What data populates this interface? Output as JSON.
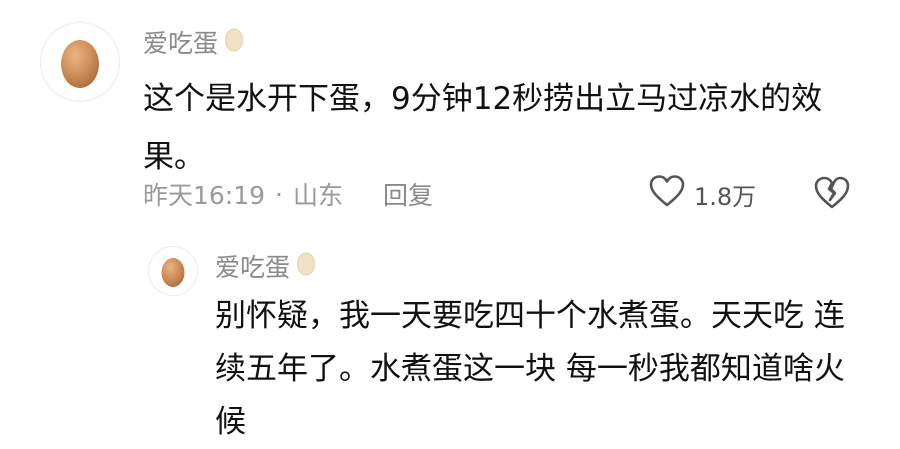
{
  "main_comment": {
    "username": "爱吃蛋",
    "content": "这个是水开下蛋，9分钟12秒捞出立马过凉水的效果。",
    "time": "昨天16:19",
    "separator": "·",
    "location": "山东",
    "reply_label": "回复",
    "like_count": "1.8万",
    "badge_icon": "egg-badge-icon",
    "avatar_icon": "egg-avatar-icon"
  },
  "reply_comment": {
    "username": "爱吃蛋",
    "content": "别怀疑，我一天要吃四十个水煮蛋。天天吃 连续五年了。水煮蛋这一块 每一秒我都知道啥火候",
    "badge_icon": "egg-badge-icon",
    "avatar_icon": "egg-avatar-icon"
  },
  "colors": {
    "text": "#111111",
    "muted": "#9a9a9a",
    "egg_brown": "#cf915c",
    "egg_cream": "#efe3c6"
  }
}
